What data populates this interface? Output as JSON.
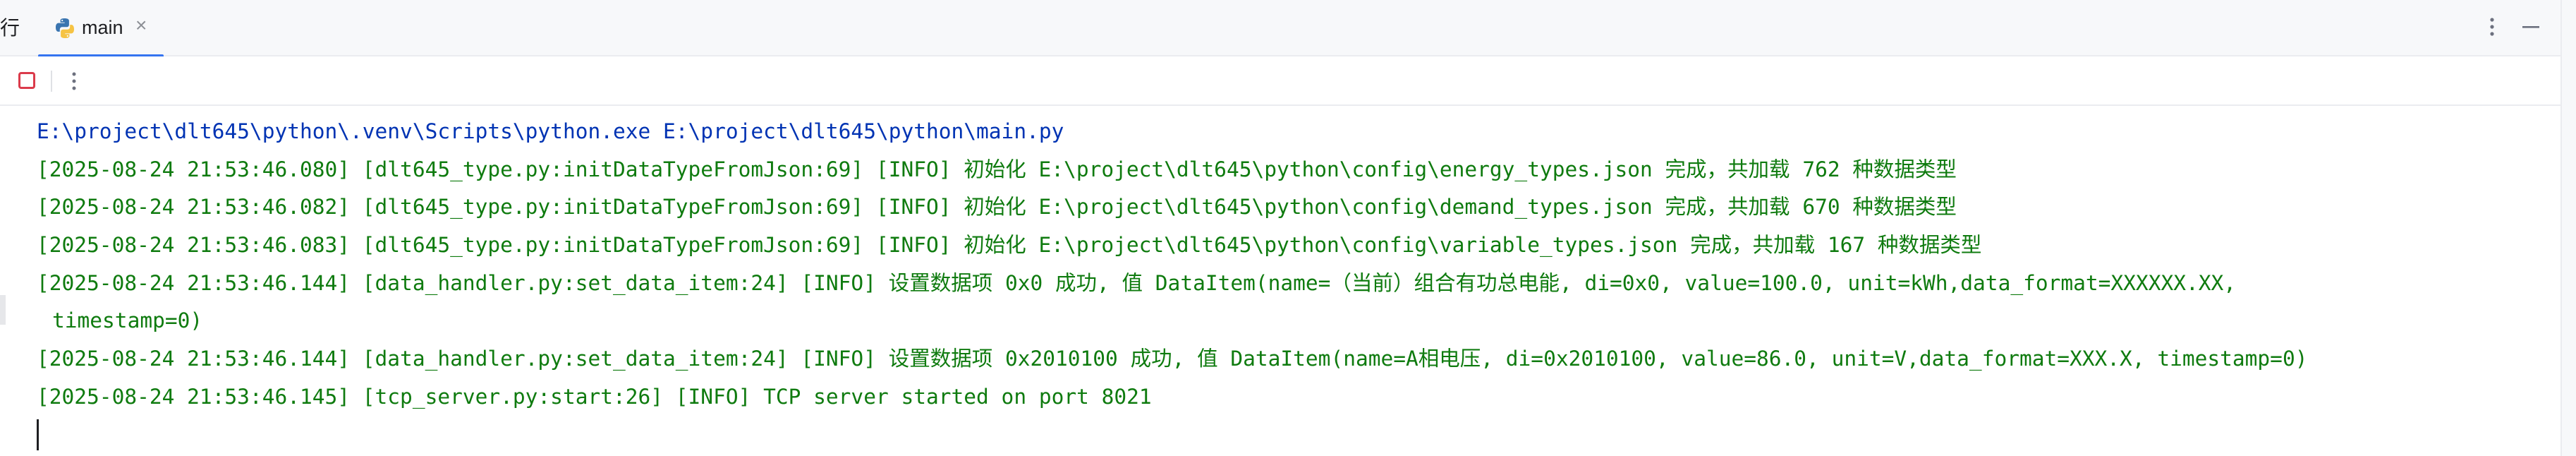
{
  "window": {
    "run_label": "行",
    "tab": {
      "label": "main",
      "close": "×",
      "icon": "python-icon"
    }
  },
  "toolbar": {
    "stop_icon": "stop-icon",
    "more_icon": "more-vertical-icon"
  },
  "header_actions": {
    "more_icon": "more-vertical-icon",
    "minimize_icon": "minimize-icon"
  },
  "console": {
    "command": "E:\\project\\dlt645\\python\\.venv\\Scripts\\python.exe E:\\project\\dlt645\\python\\main.py",
    "lines": [
      "[2025-08-24 21:53:46.080] [dlt645_type.py:initDataTypeFromJson:69] [INFO] 初始化 E:\\project\\dlt645\\python\\config\\energy_types.json 完成，共加载 762 种数据类型",
      "[2025-08-24 21:53:46.082] [dlt645_type.py:initDataTypeFromJson:69] [INFO] 初始化 E:\\project\\dlt645\\python\\config\\demand_types.json 完成，共加载 670 种数据类型",
      "[2025-08-24 21:53:46.083] [dlt645_type.py:initDataTypeFromJson:69] [INFO] 初始化 E:\\project\\dlt645\\python\\config\\variable_types.json 完成，共加载 167 种数据类型",
      "[2025-08-24 21:53:46.144] [data_handler.py:set_data_item:24] [INFO] 设置数据项 0x0 成功, 值 DataItem(name=（当前）组合有功总电能, di=0x0, value=100.0, unit=kWh,data_format=XXXXXX.XX,",
      "timestamp=0)",
      "[2025-08-24 21:53:46.144] [data_handler.py:set_data_item:24] [INFO] 设置数据项 0x2010100 成功, 值 DataItem(name=A相电压, di=0x2010100, value=86.0, unit=V,data_format=XXX.X, timestamp=0)",
      "[2025-08-24 21:53:46.145] [tcp_server.py:start:26] [INFO] TCP server started on port 8021"
    ]
  },
  "colors": {
    "accent": "#3574f0",
    "log_text": "#0f7b0f",
    "command_text": "#0033b3",
    "stop": "#db3b4b"
  }
}
